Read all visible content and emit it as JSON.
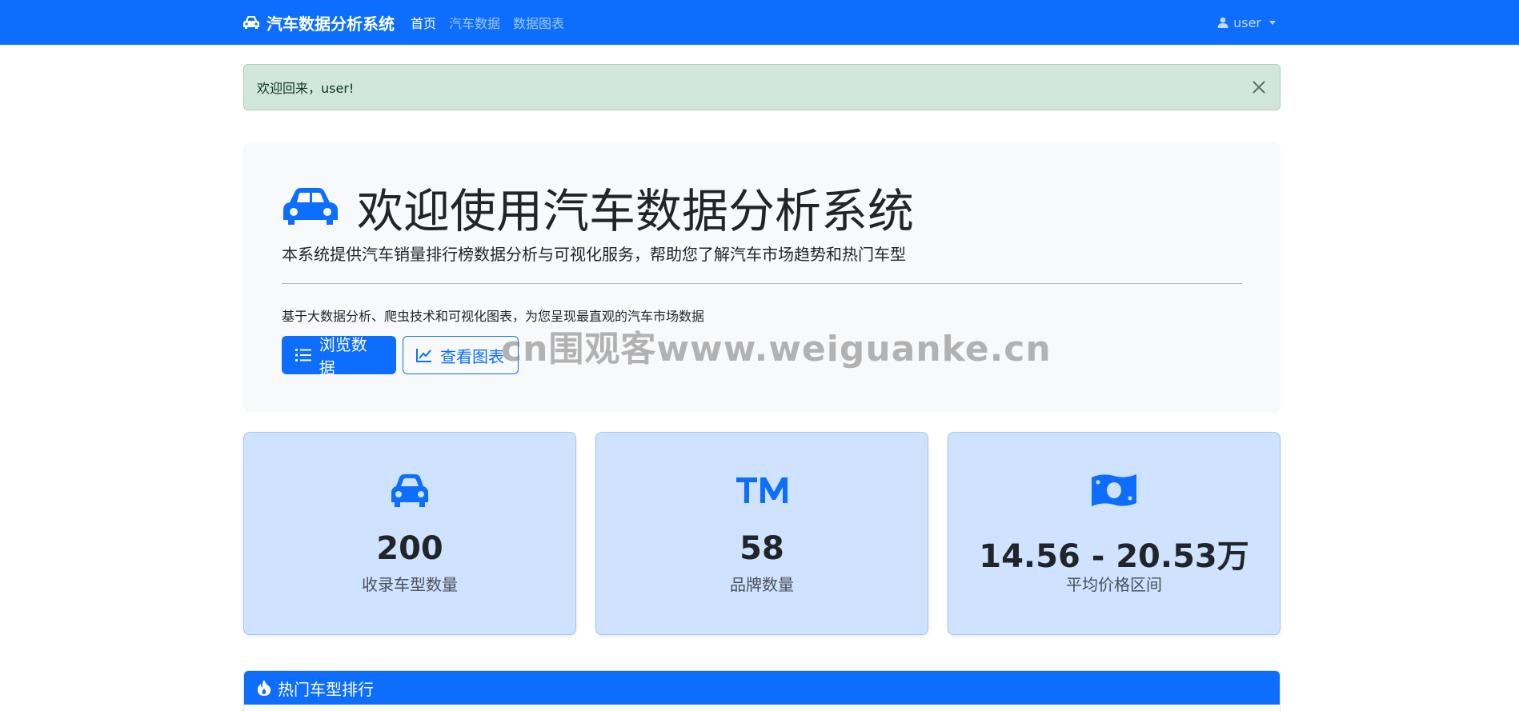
{
  "navbar": {
    "brand": "汽车数据分析系统",
    "links": [
      "首页",
      "汽车数据",
      "数据图表"
    ],
    "user": "user",
    "bg_color": "#0d6efd"
  },
  "alert": {
    "message": "欢迎回来，user!"
  },
  "hero": {
    "title": "欢迎使用汽车数据分析系统",
    "lead": "本系统提供汽车销量排行榜数据分析与可视化服务，帮助您了解汽车市场趋势和热门车型",
    "text": "基于大数据分析、爬虫技术和可视化图表，为您呈现最直观的汽车市场数据",
    "btn_browse": "浏览数据",
    "btn_charts": "查看图表"
  },
  "watermark": "cn围观客www.weiguanke.cn",
  "stats": [
    {
      "icon": "car-icon",
      "value": "200",
      "label": "收录车型数量"
    },
    {
      "icon": "trademark-icon",
      "value": "58",
      "label": "品牌数量"
    },
    {
      "icon": "money-icon",
      "value": "14.56 - 20.53万",
      "label": "平均价格区间"
    }
  ],
  "ranking": {
    "title": "热门车型排行"
  }
}
